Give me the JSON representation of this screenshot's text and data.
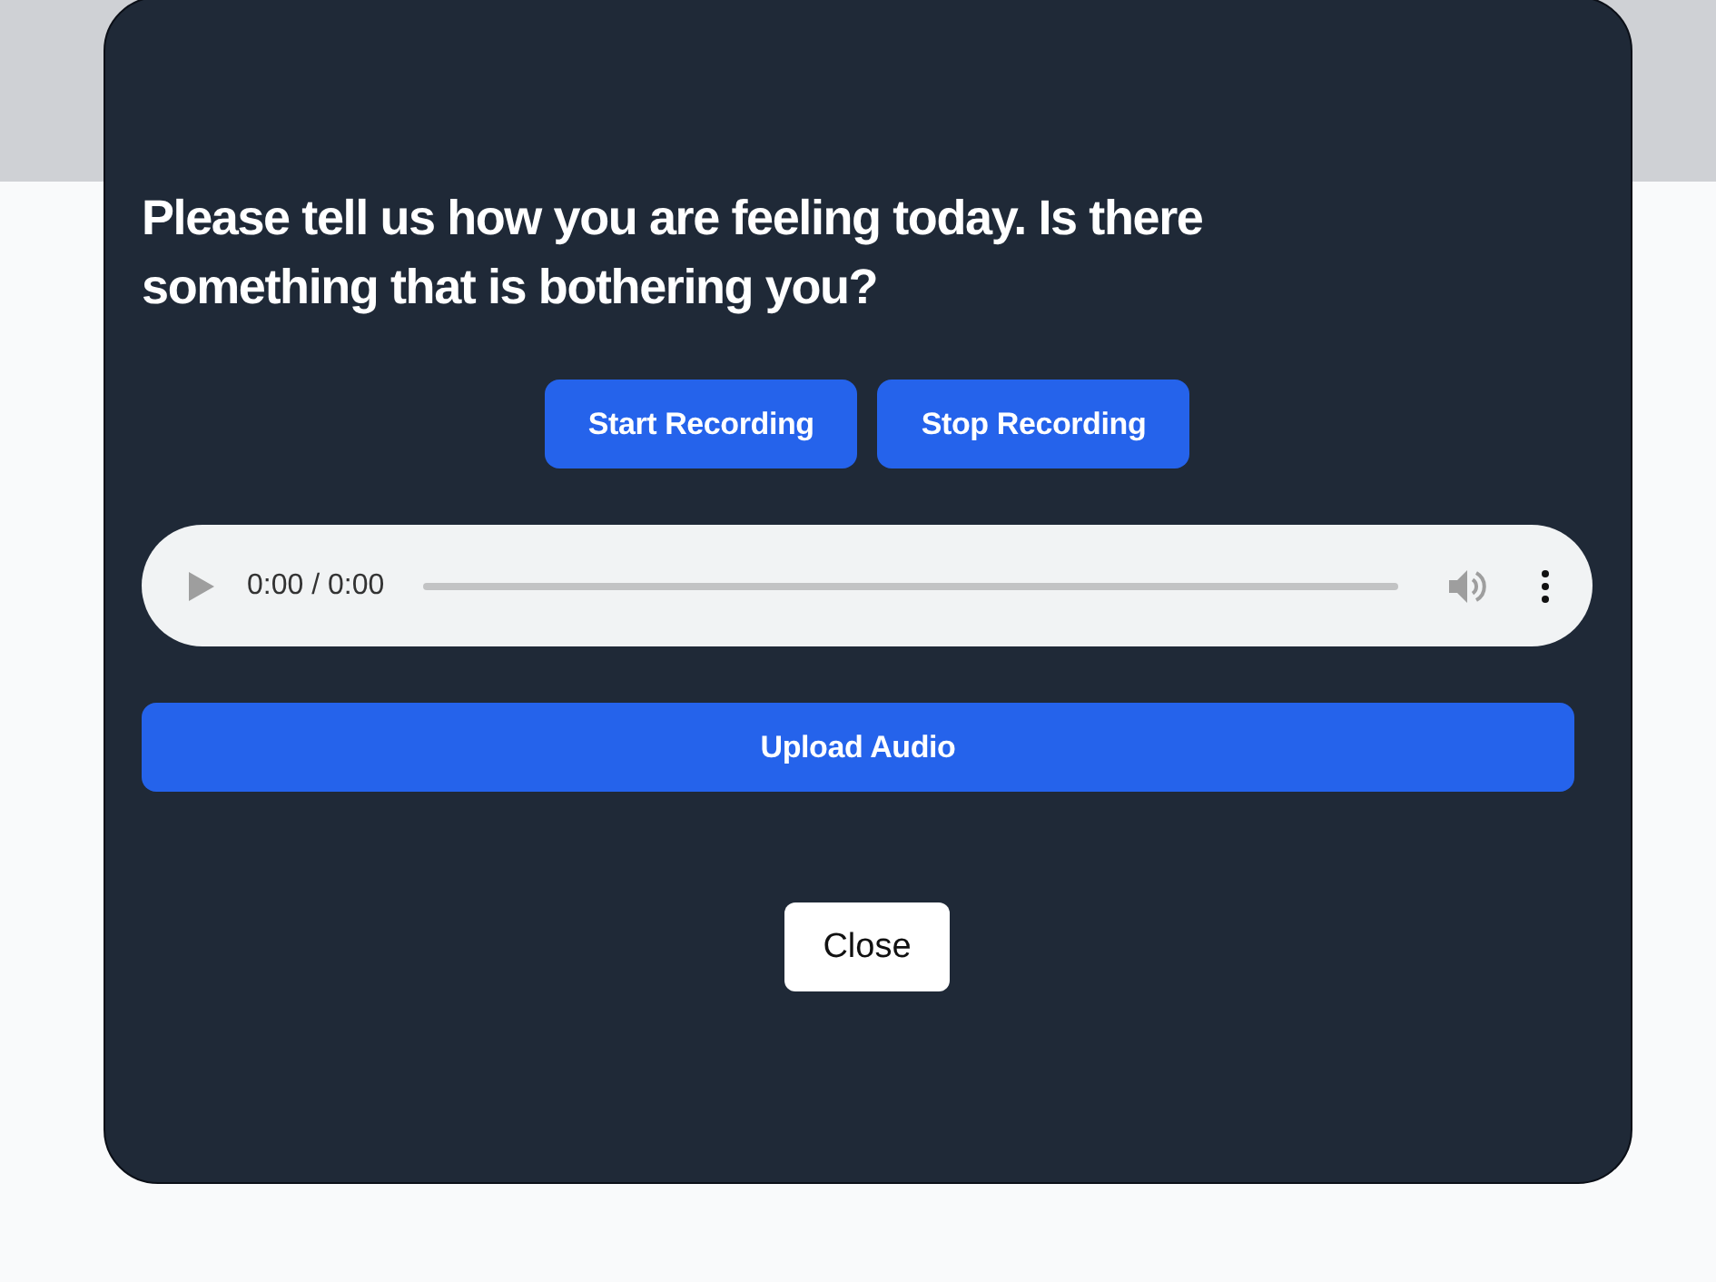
{
  "modal": {
    "heading": "Please tell us how you are feeling today. Is there something that is bothering you?",
    "recording_buttons": [
      "Start Recording",
      "Stop Recording"
    ],
    "audio_player": {
      "time": "0:00 / 0:00"
    },
    "upload_button": "Upload Audio",
    "close_button": "Close"
  }
}
